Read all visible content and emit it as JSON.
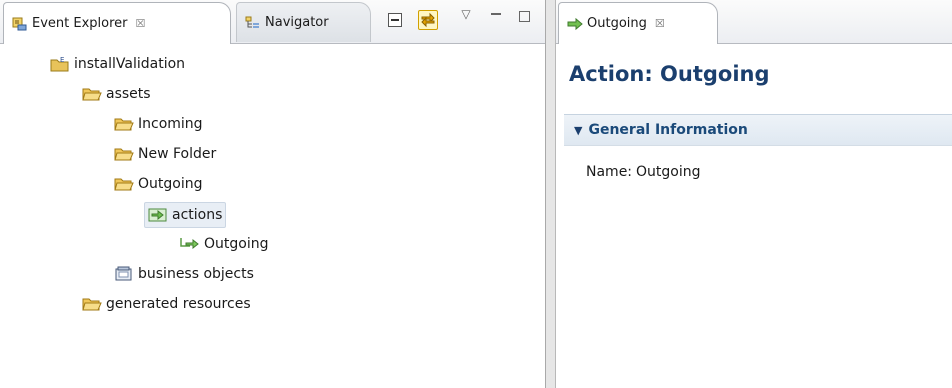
{
  "left_tabs": [
    {
      "label": "Event Explorer",
      "icon": "event-explorer-icon",
      "close": "☒"
    },
    {
      "label": "Navigator",
      "icon": "navigator-icon"
    }
  ],
  "toolbar": {
    "collapse_all": "collapse-all-icon",
    "link_with_editor": "link-with-editor-icon",
    "view_menu": "▽",
    "minimize": "▭",
    "maximize": "□"
  },
  "tree": [
    {
      "label": "installValidation",
      "icon": "project-icon",
      "level": 0
    },
    {
      "label": "assets",
      "icon": "folder-icon",
      "level": 1
    },
    {
      "label": "Incoming",
      "icon": "folder-icon",
      "level": 2
    },
    {
      "label": "New Folder",
      "icon": "folder-icon",
      "level": 2
    },
    {
      "label": "Outgoing",
      "icon": "folder-icon",
      "level": 2
    },
    {
      "label": "actions",
      "icon": "actions-icon",
      "level": 3,
      "selected": true
    },
    {
      "label": "Outgoing",
      "icon": "arrow-action-icon",
      "level": 4
    },
    {
      "label": "business objects",
      "icon": "business-object-icon",
      "level": 2
    },
    {
      "label": "generated resources",
      "icon": "folder-icon",
      "level": 1
    }
  ],
  "editor_tab": {
    "label": "Outgoing",
    "icon": "action-arrow-icon",
    "close": "☒"
  },
  "editor": {
    "title": "Action: Outgoing",
    "section_label": "General Information",
    "name_label": "Name:",
    "name_value": "Outgoing"
  },
  "colors": {
    "title": "#1b3f6e",
    "section": "#1b4a7a",
    "folder": "#e7b84a"
  }
}
